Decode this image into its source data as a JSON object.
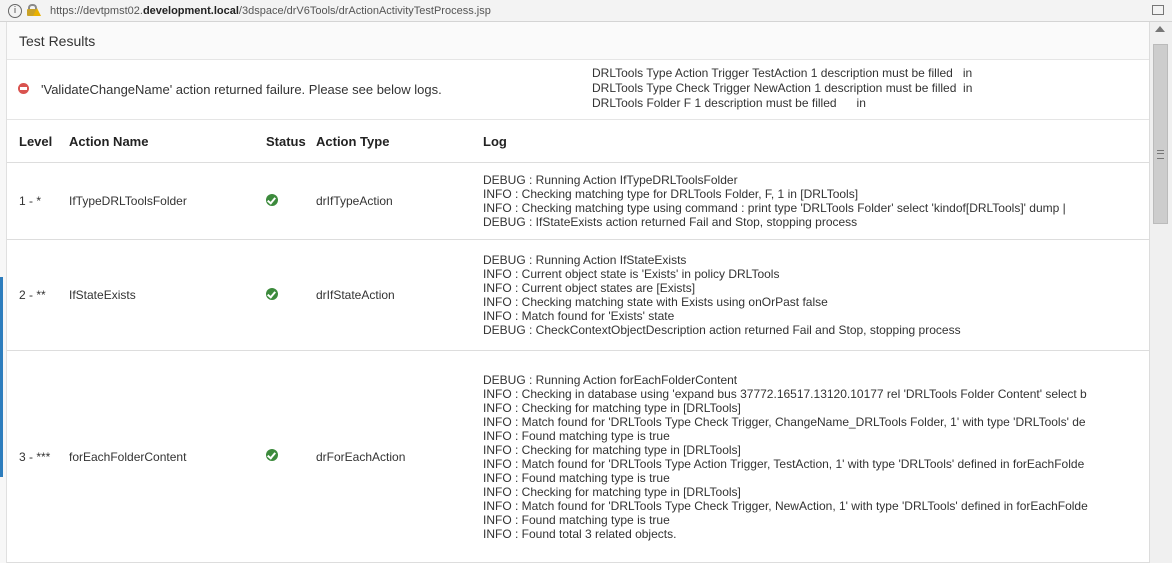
{
  "urlbar": {
    "url_prefix": "https://devtpmst02.",
    "url_domain": "development.local",
    "url_path": "/3dspace/drV6Tools/drActionActivityTestProcess.jsp",
    "info_glyph": "i"
  },
  "page": {
    "title": "Test Results"
  },
  "message": {
    "error_text": "'ValidateChangeName' action returned failure. Please see below logs.",
    "side_lines": [
      "DRLTools Type Action Trigger TestAction 1 description must be filled   in",
      "DRLTools Type Check Trigger NewAction 1 description must be filled  in",
      "DRLTools Folder F 1 description must be filled      in"
    ]
  },
  "table": {
    "headers": {
      "level": "Level",
      "action_name": "Action Name",
      "status": "Status",
      "action_type": "Action Type",
      "log": "Log"
    },
    "rows": [
      {
        "level": "1 - *",
        "action_name": "IfTypeDRLToolsFolder",
        "status": "success",
        "action_type": "drIfTypeAction",
        "log": [
          "DEBUG : Running Action IfTypeDRLToolsFolder",
          "INFO : Checking matching type for DRLTools Folder, F, 1 in [DRLTools]",
          "INFO : Checking matching type using command : print type 'DRLTools Folder' select 'kindof[DRLTools]' dump |",
          "DEBUG : IfStateExists action returned Fail and Stop, stopping process"
        ]
      },
      {
        "level": "2 - **",
        "action_name": "IfStateExists",
        "status": "success",
        "action_type": "drIfStateAction",
        "log": [
          "DEBUG : Running Action IfStateExists",
          "INFO : Current object state is 'Exists' in policy DRLTools",
          "INFO : Current object states are [Exists]",
          "INFO : Checking matching state with Exists using onOrPast false",
          "INFO : Match found for 'Exists' state",
          "DEBUG : CheckContextObjectDescription action returned Fail and Stop, stopping process"
        ]
      },
      {
        "level": "3 - ***",
        "action_name": "forEachFolderContent",
        "status": "success",
        "action_type": "drForEachAction",
        "log": [
          "DEBUG : Running Action forEachFolderContent",
          "INFO : Checking in database using 'expand bus 37772.16517.13120.10177 rel 'DRLTools Folder Content' select b",
          "INFO : Checking for matching type in [DRLTools]",
          "INFO : Match found for 'DRLTools Type Check Trigger, ChangeName_DRLTools Folder, 1'  with type 'DRLTools' de",
          "INFO : Found matching type is true",
          "INFO : Checking for matching type in [DRLTools]",
          "INFO : Match found for 'DRLTools Type Action Trigger, TestAction, 1'  with type 'DRLTools' defined in forEachFolde",
          "INFO : Found matching type is true",
          "INFO : Checking for matching type in [DRLTools]",
          "INFO : Match found for 'DRLTools Type Check Trigger, NewAction, 1'  with type 'DRLTools' defined in forEachFolde",
          "INFO : Found matching type is true",
          "INFO : Found total 3 related objects."
        ]
      }
    ]
  },
  "colors": {
    "error": "#d9534f",
    "success": "#3c8a3c"
  },
  "icons": {
    "urlbar": [
      "info-icon",
      "lock-warning-icon",
      "reader-view-icon"
    ],
    "message": "error-icon",
    "status": "checkmark-circle-icon",
    "scrollbar": [
      "scroll-up-arrow-icon",
      "scroll-grip-icon"
    ]
  }
}
